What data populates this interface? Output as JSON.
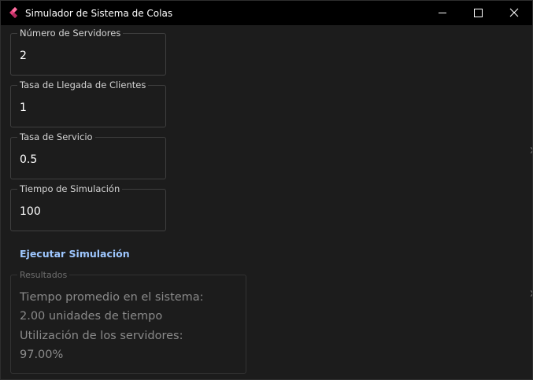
{
  "window": {
    "title": "Simulador de Sistema de Colas",
    "icon": "app-logo-icon",
    "controls": [
      "minimize-icon",
      "maximize-icon",
      "close-icon"
    ]
  },
  "fields": [
    {
      "label": "Número de Servidores",
      "value": "2"
    },
    {
      "label": "Tasa de Llegada de Clientes",
      "value": "1"
    },
    {
      "label": "Tasa de Servicio",
      "value": "0.5"
    },
    {
      "label": "Tiempo de Simulación",
      "value": "100"
    }
  ],
  "run_button": {
    "label": "Ejecutar Simulación"
  },
  "results": {
    "label": "Resultados",
    "lines": [
      "Tiempo promedio en el sistema:",
      "2.00 unidades de tiempo",
      "Utilización de los servidores:",
      "97.00%"
    ]
  },
  "colors": {
    "background": "#1c1c1c",
    "titlebar": "#000000",
    "accent": "#9ec7ff",
    "field_border": "#3f3f3f",
    "disabled_text": "#8a8a8a"
  }
}
